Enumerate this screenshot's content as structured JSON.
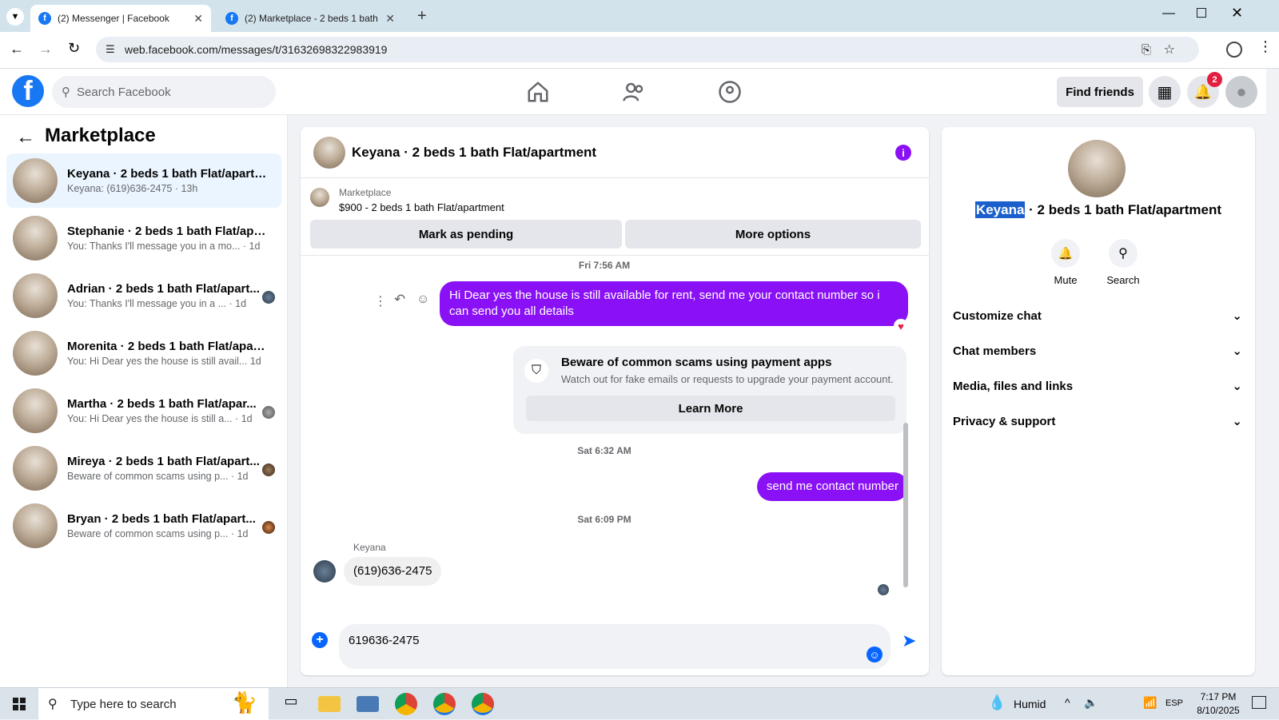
{
  "browser": {
    "tabs": [
      {
        "title": "(2) Messenger | Facebook",
        "active": true
      },
      {
        "title": "(2) Marketplace - 2 beds 1 bath",
        "active": false
      }
    ],
    "url": "web.facebook.com/messages/t/31632698322983919"
  },
  "header": {
    "search_placeholder": "Search Facebook",
    "find_friends": "Find friends",
    "notification_count": "2",
    "brand_color": "#1877f2"
  },
  "sidebar": {
    "title": "Marketplace",
    "conversations": [
      {
        "name": "Keyana · 2 beds 1 bath Flat/apartm...",
        "snippet": "Keyana: (619)636-2475 · 13h"
      },
      {
        "name": "Stephanie · 2 beds 1 bath Flat/apar...",
        "snippet": "You: Thanks I'll message you in a mo... · 1d"
      },
      {
        "name": "Adrian · 2 beds 1 bath Flat/apart...",
        "snippet": "You: Thanks I'll message you in a ... · 1d"
      },
      {
        "name": "Morenita · 2 beds 1 bath Flat/apart...",
        "snippet": "You: Hi Dear yes the house is still avail... 1d"
      },
      {
        "name": "Martha · 2 beds 1 bath Flat/apar...",
        "snippet": "You: Hi Dear yes the house is still a... · 1d"
      },
      {
        "name": "Mireya · 2 beds 1 bath Flat/apart...",
        "snippet": "Beware of common scams using p... · 1d"
      },
      {
        "name": "Bryan · 2 beds 1 bath Flat/apart...",
        "snippet": "Beware of common scams using p... · 1d"
      }
    ]
  },
  "chat": {
    "title": "Keyana · 2 beds 1 bath Flat/apartment",
    "marketplace_label": "Marketplace",
    "listing": "$900 - 2 beds 1 bath Flat/apartment",
    "mark_pending": "Mark as pending",
    "more_options": "More options",
    "stamp1": "Fri 7:56 AM",
    "msg1": "Hi Dear yes the house is still available for rent, send me your contact number so i can send you all details",
    "scam_title": "Beware of common scams using payment apps",
    "scam_body": "Watch out for fake emails or requests to upgrade your payment account.",
    "learn_more": "Learn More",
    "stamp2": "Sat 6:32 AM",
    "msg2": "send me contact number",
    "stamp3": "Sat 6:09 PM",
    "sender": "Keyana",
    "msg3": "(619)636-2475",
    "composer_value": "619636-2475",
    "accent_color": "#8a11f5"
  },
  "info": {
    "name_highlight": "Keyana",
    "name_rest": " · 2 beds 1 bath Flat/apartment",
    "mute": "Mute",
    "search": "Search",
    "sections": [
      "Customize chat",
      "Chat members",
      "Media, files and links",
      "Privacy & support"
    ]
  },
  "taskbar": {
    "search_placeholder": "Type here to search",
    "weather": "Humid",
    "lang": "ESP",
    "time": "7:17 PM",
    "date": "8/10/2025"
  }
}
